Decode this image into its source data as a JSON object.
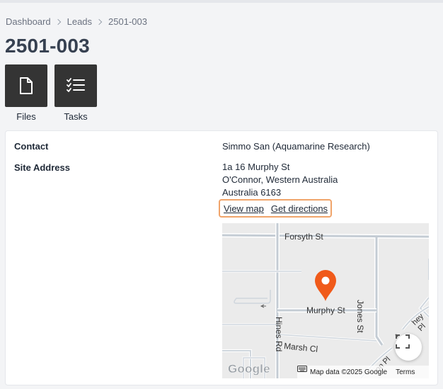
{
  "breadcrumb": [
    "Dashboard",
    "Leads",
    "2501-003"
  ],
  "page_title": "2501-003",
  "actions": [
    {
      "label": "Files",
      "icon": "file-icon"
    },
    {
      "label": "Tasks",
      "icon": "checklist-icon"
    }
  ],
  "details": {
    "contact_label": "Contact",
    "contact_value": "Simmo San (Aquamarine Research)",
    "site_address_label": "Site Address",
    "address_lines": [
      "1a 16 Murphy St",
      "O'Connor, Western Australia",
      "Australia 6163"
    ],
    "view_map": "View map",
    "get_directions": "Get directions"
  },
  "map": {
    "streets": {
      "forsyth": "Forsyth St",
      "murphy": "Murphy St",
      "jones": "Jones St",
      "hines": "Hines Rd",
      "marsh": "Marsh Cl",
      "partial_1": "hey Pl",
      "partial_2": "on Pl"
    },
    "logo": "Google",
    "attribution": "Map data ©2025 Google",
    "terms": "Terms",
    "marker_color": "#f05a1a"
  }
}
